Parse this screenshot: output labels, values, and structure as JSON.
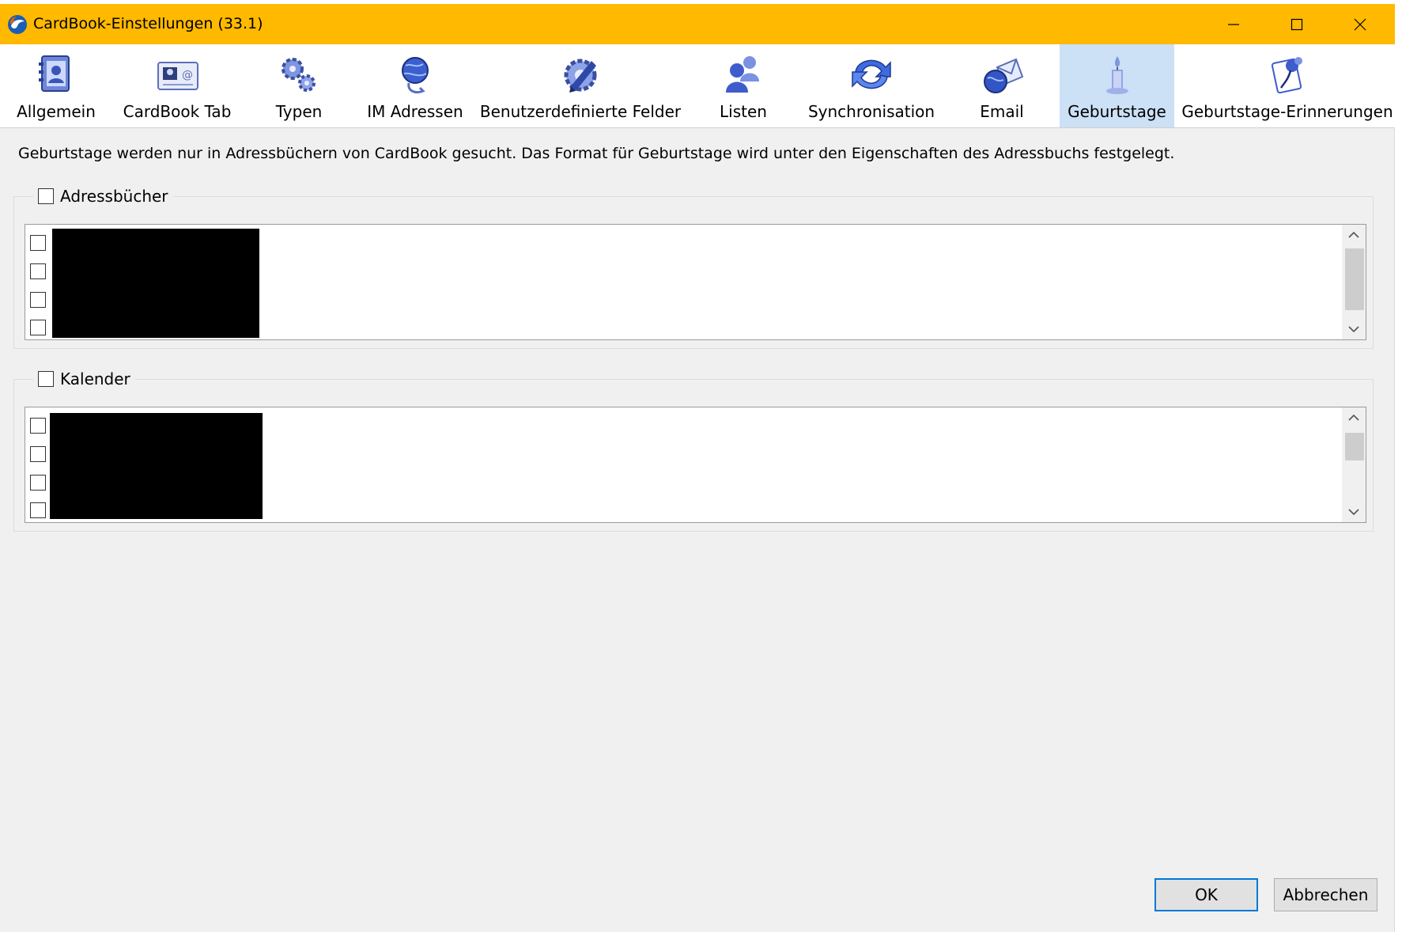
{
  "window": {
    "title": "CardBook-Einstellungen (33.1)",
    "accent_color": "#ffb900",
    "controls": {
      "minimize_icon": "minimize-icon",
      "maximize_icon": "maximize-icon",
      "close_icon": "close-icon"
    }
  },
  "toolbar": {
    "selected": "Geburtstage",
    "selected_color": "#cce0f6",
    "items": [
      {
        "label": "Allgemein",
        "icon": "address-book-icon"
      },
      {
        "label": "CardBook Tab",
        "icon": "contact-card-icon"
      },
      {
        "label": "Typen",
        "icon": "gears-icon"
      },
      {
        "label": "IM Adressen",
        "icon": "globe-chat-icon"
      },
      {
        "label": "Benutzerdefinierte Felder",
        "icon": "gear-pencil-icon"
      },
      {
        "label": "Listen",
        "icon": "users-group-icon"
      },
      {
        "label": "Synchronisation",
        "icon": "sync-arrows-icon"
      },
      {
        "label": "Email",
        "icon": "globe-envelope-icon"
      },
      {
        "label": "Geburtstage",
        "icon": "candle-icon"
      },
      {
        "label": "Geburtstage-Erinnerungen",
        "icon": "flower-reminder-icon"
      }
    ]
  },
  "content": {
    "description": "Geburtstage werden nur in Adressbüchern von CardBook gesucht. Das Format für Geburtstage wird unter den Eigenschaften des Adressbuchs festgelegt.",
    "addressbooks": {
      "label": "Adressbücher",
      "checked": false,
      "rows": [
        "",
        "",
        "",
        ""
      ],
      "redacted": true
    },
    "calendars": {
      "label": "Kalender",
      "checked": false,
      "rows": [
        "",
        "",
        "",
        ""
      ],
      "redacted": true
    }
  },
  "footer": {
    "ok_label": "OK",
    "cancel_label": "Abbrechen"
  }
}
